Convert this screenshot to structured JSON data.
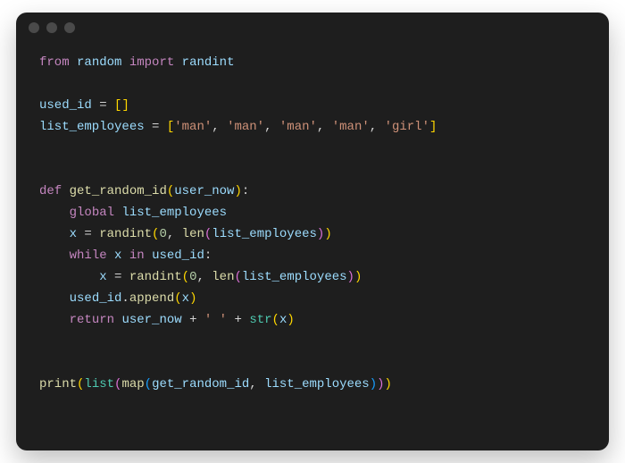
{
  "titlebar": {
    "dots": 3
  },
  "code": {
    "line1_kw_from": "from",
    "line1_mod": "random",
    "line1_kw_import": "import",
    "line1_name": "randint",
    "line3_var": "used_id",
    "line3_eq": "=",
    "line4_var": "list_employees",
    "line4_eq": "=",
    "line4_s1": "'man'",
    "line4_s2": "'man'",
    "line4_s3": "'man'",
    "line4_s4": "'man'",
    "line4_s5": "'girl'",
    "line7_def": "def",
    "line7_fn": "get_random_id",
    "line7_param": "user_now",
    "line8_global": "global",
    "line8_var": "list_employees",
    "line9_x": "x",
    "line9_eq": "=",
    "line9_fn": "randint",
    "line9_zero": "0",
    "line9_len": "len",
    "line9_arg": "list_employees",
    "line10_while": "while",
    "line10_x": "x",
    "line10_in": "in",
    "line10_used": "used_id",
    "line11_x": "x",
    "line11_eq": "=",
    "line11_fn": "randint",
    "line11_zero": "0",
    "line11_len": "len",
    "line11_arg": "list_employees",
    "line12_used": "used_id",
    "line12_append": "append",
    "line12_x": "x",
    "line13_return": "return",
    "line13_usernow": "user_now",
    "line13_plus1": "+",
    "line13_space": "' '",
    "line13_plus2": "+",
    "line13_str": "str",
    "line13_x": "x",
    "line16_print": "print",
    "line16_list": "list",
    "line16_map": "map",
    "line16_a1": "get_random_id",
    "line16_a2": "list_employees"
  }
}
